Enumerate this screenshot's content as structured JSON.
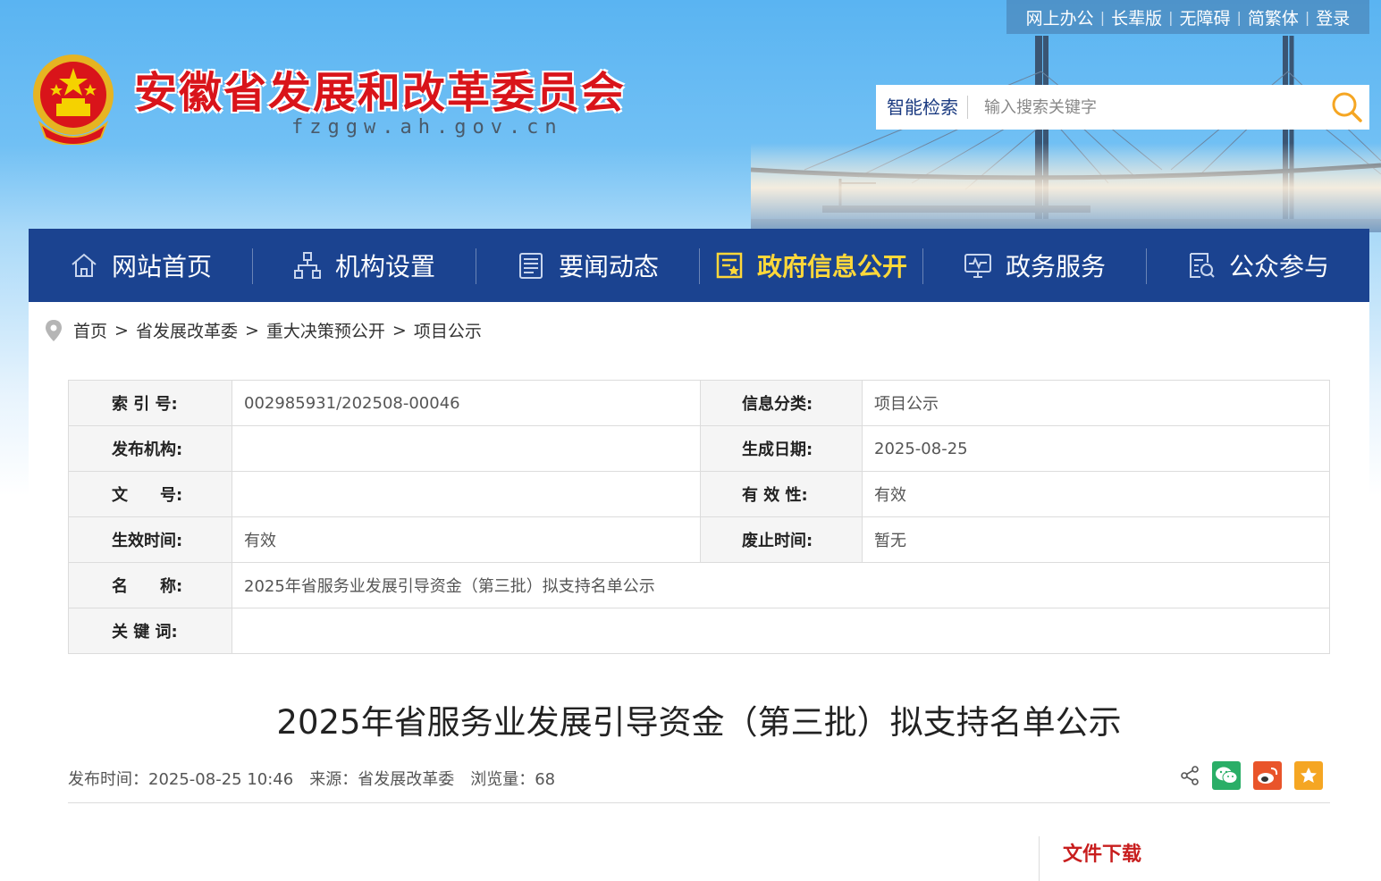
{
  "top_links": [
    "网上办公",
    "长辈版",
    "无障碍",
    "简繁体",
    "登录"
  ],
  "site": {
    "title": "安徽省发展和改革委员会",
    "domain": "fzggw.ah.gov.cn"
  },
  "search": {
    "label": "智能检索",
    "placeholder": "输入搜索关键字"
  },
  "nav": [
    {
      "label": "网站首页",
      "icon": "home-icon",
      "active": false
    },
    {
      "label": "机构设置",
      "icon": "org-chart-icon",
      "active": false
    },
    {
      "label": "要闻动态",
      "icon": "news-icon",
      "active": false
    },
    {
      "label": "政府信息公开",
      "icon": "info-disclosure-icon",
      "active": true
    },
    {
      "label": "政务服务",
      "icon": "monitor-icon",
      "active": false
    },
    {
      "label": "公众参与",
      "icon": "participation-icon",
      "active": false
    }
  ],
  "breadcrumb": [
    "首页",
    "省发展改革委",
    "重大决策预公开",
    "项目公示"
  ],
  "meta": {
    "index_label": "索 引 号:",
    "index_value": "002985931/202508-00046",
    "category_label": "信息分类:",
    "category_value": "项目公示",
    "publisher_label": "发布机构:",
    "publisher_value": "",
    "gen_date_label": "生成日期:",
    "gen_date_value": "2025-08-25",
    "doc_no_label": "文　　号:",
    "doc_no_value": "",
    "validity_label": "有 效 性:",
    "validity_value": "有效",
    "effective_label": "生效时间:",
    "effective_value": "有效",
    "abolish_label": "废止时间:",
    "abolish_value": "暂无",
    "name_label": "名　　称:",
    "name_value": "2025年省服务业发展引导资金（第三批）拟支持名单公示",
    "keywords_label": "关 键 词:",
    "keywords_value": ""
  },
  "article": {
    "title": "2025年省服务业发展引导资金（第三批）拟支持名单公示",
    "publish_time": "发布时间：2025-08-25 10:46",
    "source": "来源：省发展改革委",
    "views": "浏览量：68"
  },
  "download": {
    "title": "文件下载"
  },
  "colors": {
    "nav_bg": "#1b4390",
    "nav_active": "#ffd83a",
    "title_red": "#d9141a",
    "wechat": "#2aae67",
    "weibo": "#e9542a",
    "favorite": "#f5a623"
  }
}
